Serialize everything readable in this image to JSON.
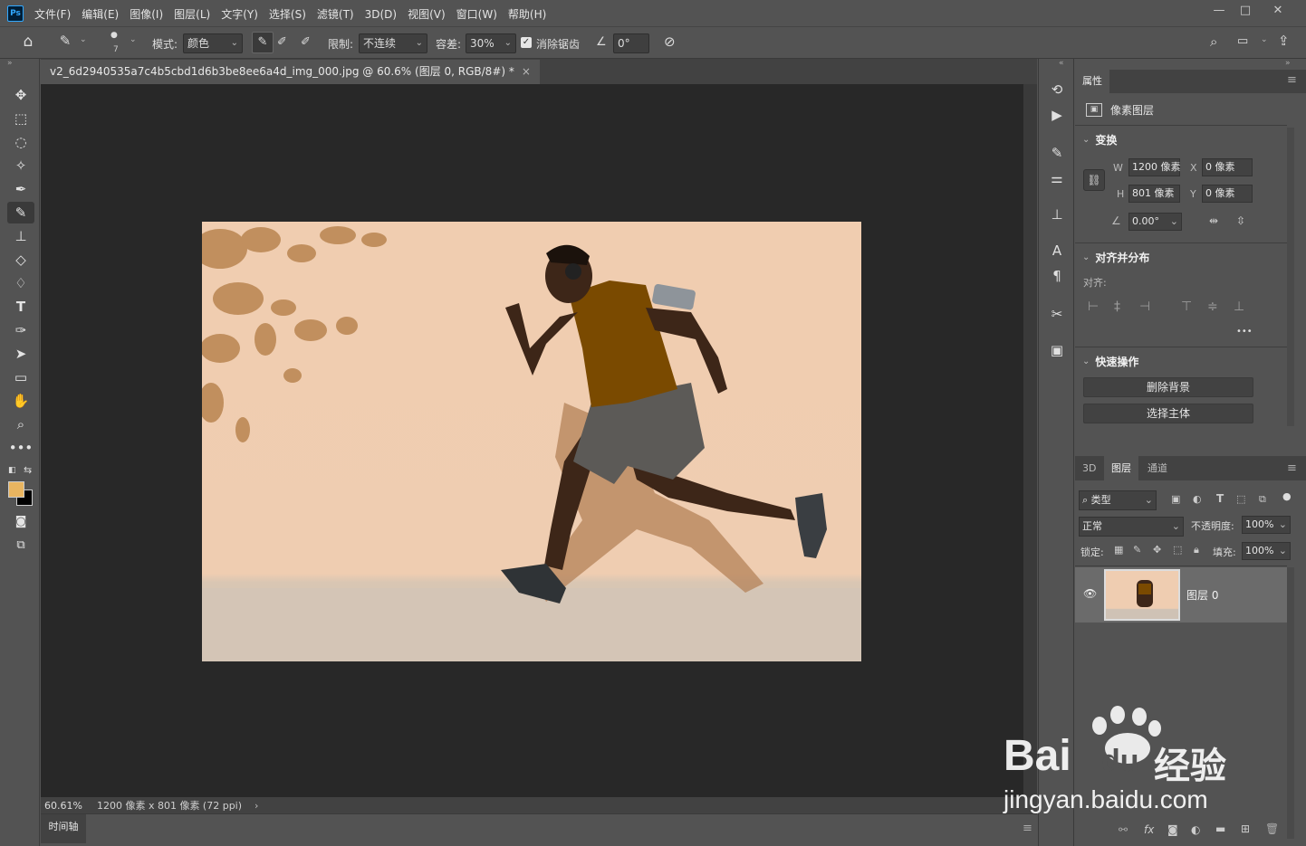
{
  "app": {
    "logo": "Ps"
  },
  "menu": [
    "文件(F)",
    "编辑(E)",
    "图像(I)",
    "图层(L)",
    "文字(Y)",
    "选择(S)",
    "滤镜(T)",
    "3D(D)",
    "视图(V)",
    "窗口(W)",
    "帮助(H)"
  ],
  "window_controls": {
    "minimize": "—",
    "maximize": "□",
    "close": "✕"
  },
  "options": {
    "brush_size": "7",
    "mode_label": "模式:",
    "mode_value": "颜色",
    "limit_label": "限制:",
    "limit_value": "不连续",
    "tolerance_label": "容差:",
    "tolerance_value": "30%",
    "antialias_label": "消除锯齿",
    "antialias_checked": true,
    "angle_value": "0°"
  },
  "document": {
    "tab_title": "v2_6d2940535a7c4b5cbd1d6b3be8ee6a4d_img_000.jpg @ 60.6% (图层 0, RGB/8#) *",
    "tab_close": "×",
    "zoom": "60.61%",
    "dimensions": "1200 像素 x 801 像素 (72 ppi)",
    "status_arrow": "›"
  },
  "timeline": {
    "label": "时间轴"
  },
  "colors": {
    "foreground": "#e9b560",
    "background": "#000000",
    "shirt": "#7a4a00",
    "wall": "#efcdb1"
  },
  "properties": {
    "tab": "属性",
    "layer_type": "像素图层",
    "transform": {
      "title": "变换",
      "w_label": "W",
      "w_value": "1200 像素",
      "h_label": "H",
      "h_value": "801 像素",
      "x_label": "X",
      "x_value": "0 像素",
      "y_label": "Y",
      "y_value": "0 像素",
      "angle_value": "0.00°"
    },
    "align": {
      "title": "对齐并分布",
      "label": "对齐:",
      "more": "•••"
    },
    "quick": {
      "title": "快速操作",
      "remove_bg": "删除背景",
      "select_subject": "选择主体"
    }
  },
  "layers_panel": {
    "tabs": [
      "3D",
      "图层",
      "通道"
    ],
    "active_tab": "图层",
    "filter_value": "类型",
    "blend_mode": "正常",
    "opacity_label": "不透明度:",
    "opacity_value": "100%",
    "lock_label": "锁定:",
    "fill_label": "填充:",
    "fill_value": "100%",
    "layers": [
      {
        "name": "图层 0",
        "visible": true
      }
    ]
  },
  "watermark": {
    "brand": "Bai",
    "brand2": "du",
    "cn": "经验",
    "url": "jingyan.baidu.com"
  }
}
